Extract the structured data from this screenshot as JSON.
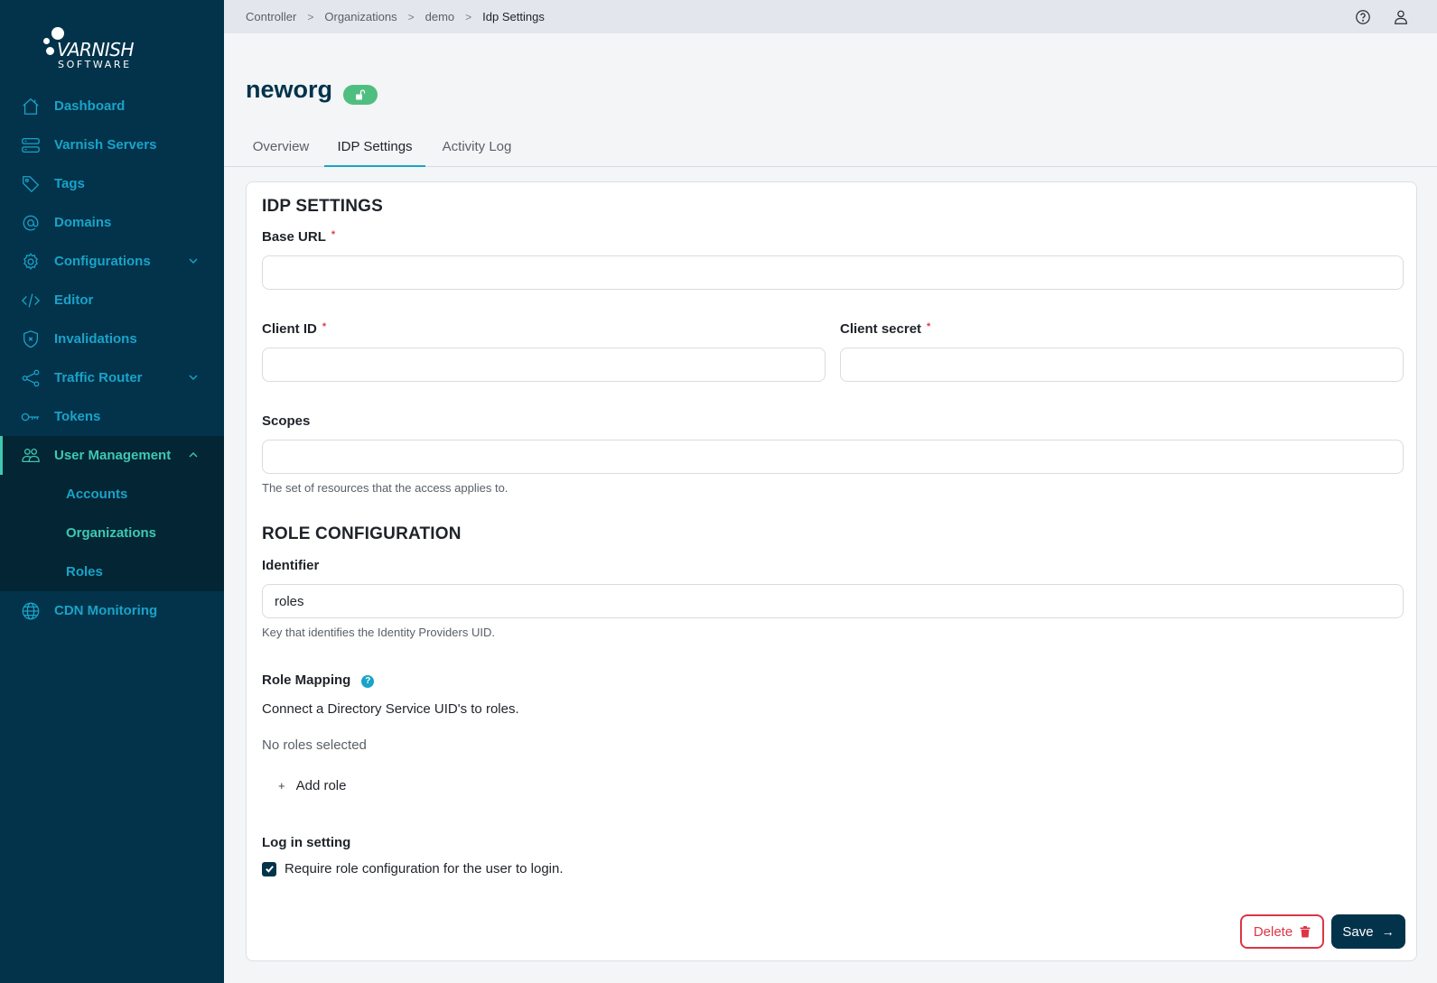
{
  "brand": {
    "name": "VARNISH",
    "tagline": "SOFTWARE"
  },
  "colors": {
    "sidebar_bg": "#02334b",
    "accent": "#1aa3c8",
    "active": "#3ec9b0",
    "danger": "#dc3545",
    "primary": "#02334b",
    "badge": "#4fbf7f"
  },
  "sidebar": {
    "items": [
      {
        "label": "Dashboard",
        "icon": "home-icon"
      },
      {
        "label": "Varnish Servers",
        "icon": "servers-icon"
      },
      {
        "label": "Tags",
        "icon": "tag-icon"
      },
      {
        "label": "Domains",
        "icon": "at-icon"
      },
      {
        "label": "Configurations",
        "icon": "gear-icon",
        "expandable": true
      },
      {
        "label": "Editor",
        "icon": "code-icon"
      },
      {
        "label": "Invalidations",
        "icon": "shield-x-icon"
      },
      {
        "label": "Traffic Router",
        "icon": "share-icon",
        "expandable": true
      },
      {
        "label": "Tokens",
        "icon": "key-icon"
      },
      {
        "label": "User Management",
        "icon": "users-icon",
        "expandable": true,
        "expanded": true,
        "active": true,
        "children": [
          {
            "label": "Accounts"
          },
          {
            "label": "Organizations",
            "current": true
          },
          {
            "label": "Roles"
          }
        ]
      },
      {
        "label": "CDN Monitoring",
        "icon": "globe-icon"
      }
    ]
  },
  "breadcrumb": [
    "Controller",
    "Organizations",
    "demo",
    "Idp Settings"
  ],
  "topbar": {
    "help_icon": "help-circle-icon",
    "user_icon": "user-icon"
  },
  "page": {
    "title": "neworg",
    "badge_icon": "unlock-icon",
    "tabs": [
      {
        "label": "Overview"
      },
      {
        "label": "IDP Settings",
        "active": true
      },
      {
        "label": "Activity Log"
      }
    ]
  },
  "form": {
    "idp_section_title": "IDP SETTINGS",
    "base_url": {
      "label": "Base URL",
      "required": "*",
      "value": "",
      "placeholder": ""
    },
    "client_id": {
      "label": "Client ID",
      "required": "*",
      "value": "",
      "placeholder": ""
    },
    "client_secret": {
      "label": "Client secret",
      "required": "*",
      "value": "",
      "placeholder": ""
    },
    "scopes": {
      "label": "Scopes",
      "value": "",
      "placeholder": "",
      "hint": "The set of resources that the access applies to."
    },
    "role_section_title": "ROLE CONFIGURATION",
    "identifier": {
      "label": "Identifier",
      "value": "roles",
      "hint": "Key that identifies the Identity Providers UID."
    },
    "role_mapping": {
      "label": "Role Mapping",
      "help": "?",
      "description": "Connect a Directory Service UID's to roles.",
      "empty_text": "No roles selected",
      "add_label": "Add role",
      "add_icon": "+"
    },
    "login_setting": {
      "label": "Log in setting",
      "checkbox_label": "Require role configuration for the user to login.",
      "checked": true
    },
    "actions": {
      "delete_label": "Delete",
      "save_label": "Save",
      "save_arrow": "→"
    }
  }
}
